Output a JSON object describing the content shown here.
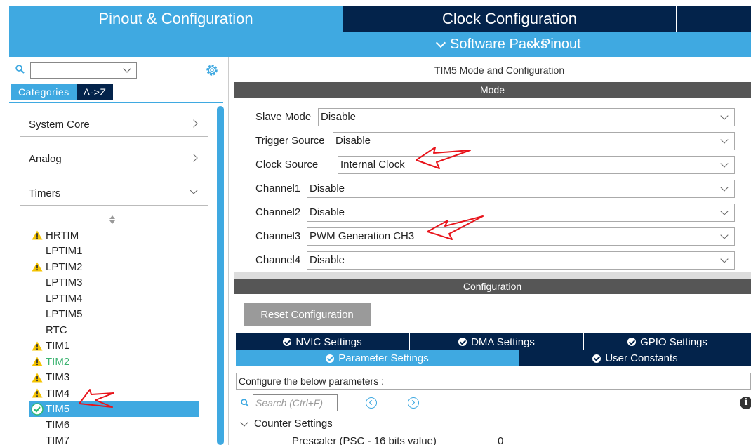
{
  "top_tabs": {
    "pinout": "Pinout & Configuration",
    "clock": "Clock Configuration"
  },
  "subbar": {
    "software_packs": "Software Packs",
    "pinout": "Pinout"
  },
  "left": {
    "search_value": "",
    "tabs": [
      "Categories",
      "A->Z"
    ],
    "categories": [
      "System Core",
      "Analog",
      "Timers"
    ],
    "timers": [
      {
        "name": "HRTIM",
        "status": "warning"
      },
      {
        "name": "LPTIM1",
        "status": "none"
      },
      {
        "name": "LPTIM2",
        "status": "warning"
      },
      {
        "name": "LPTIM3",
        "status": "none"
      },
      {
        "name": "LPTIM4",
        "status": "none"
      },
      {
        "name": "LPTIM5",
        "status": "none"
      },
      {
        "name": "RTC",
        "status": "none"
      },
      {
        "name": "TIM1",
        "status": "warning"
      },
      {
        "name": "TIM2",
        "status": "warning-green"
      },
      {
        "name": "TIM3",
        "status": "warning"
      },
      {
        "name": "TIM4",
        "status": "warning"
      },
      {
        "name": "TIM5",
        "status": "ok-selected"
      },
      {
        "name": "TIM6",
        "status": "none"
      },
      {
        "name": "TIM7",
        "status": "none"
      }
    ]
  },
  "right": {
    "title": "TIM5 Mode and Configuration",
    "mode_header": "Mode",
    "mode_rows": [
      {
        "label": "Slave Mode",
        "value": "Disable"
      },
      {
        "label": "Trigger Source",
        "value": "Disable"
      },
      {
        "label": "Clock Source",
        "value": "Internal Clock"
      },
      {
        "label": "Channel1",
        "value": "Disable"
      },
      {
        "label": "Channel2",
        "value": "Disable"
      },
      {
        "label": "Channel3",
        "value": "PWM Generation CH3"
      },
      {
        "label": "Channel4",
        "value": "Disable"
      }
    ],
    "config_header": "Configuration",
    "reset_button": "Reset Configuration",
    "tabs_row1": [
      "NVIC Settings",
      "DMA Settings",
      "GPIO Settings"
    ],
    "tabs_row2": [
      "Parameter Settings",
      "User Constants"
    ],
    "configure_text": "Configure the below parameters :",
    "search_placeholder": "Search (Ctrl+F)",
    "counter_settings": "Counter Settings",
    "prescaler_label": "Prescaler (PSC - 16 bits value)",
    "prescaler_value": "0"
  },
  "colors": {
    "accent": "#3fa9e1",
    "dark": "#03234b",
    "warning": "#f5c400",
    "ok": "#2eb872",
    "annotation": "#e8141b"
  }
}
